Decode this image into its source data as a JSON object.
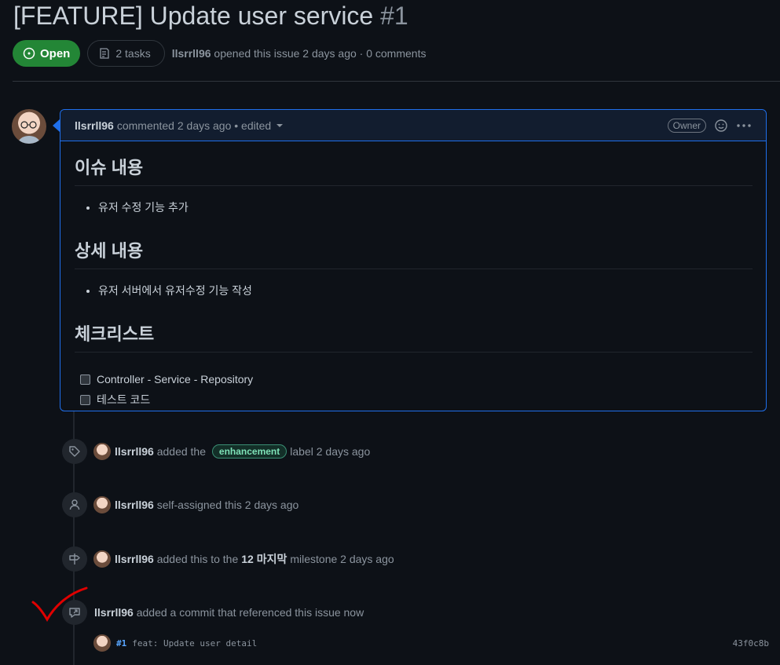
{
  "issue": {
    "title": "[FEATURE] Update user service",
    "number": "#1",
    "state": "Open",
    "tasks": "2 tasks",
    "author": "llsrrll96",
    "opened_text": "opened this issue 2 days ago · 0 comments"
  },
  "comment": {
    "author": "llsrrll96",
    "meta": "commented 2 days ago • edited",
    "badge": "Owner",
    "sections": [
      {
        "heading": "이슈 내용",
        "bullets": [
          "유저 수정 기능 추가"
        ]
      },
      {
        "heading": "상세 내용",
        "bullets": [
          "유저 서버에서 유저수정 기능 작성"
        ]
      },
      {
        "heading": "체크리스트"
      }
    ],
    "tasks": [
      "Controller - Service - Repository",
      "테스트 코드"
    ]
  },
  "timeline": {
    "label_event": {
      "user": "llsrrll96",
      "before": "added the",
      "label": "enhancement",
      "after": "label 2 days ago"
    },
    "assign_event": {
      "user": "llsrrll96",
      "text": "self-assigned this 2 days ago"
    },
    "milestone_event": {
      "user": "llsrrll96",
      "before": "added this to the",
      "milestone": "12 마지막",
      "after": "milestone 2 days ago"
    },
    "commit_event": {
      "user": "llsrrll96",
      "text": "added a commit that referenced this issue now"
    },
    "commit": {
      "ref": "#1",
      "message": "feat: Update user detail",
      "sha": "43f0c8b"
    }
  },
  "colors": {
    "open": "#238636",
    "accent": "#1f6feb",
    "background": "#0d1117",
    "annotation": "#e00000"
  }
}
